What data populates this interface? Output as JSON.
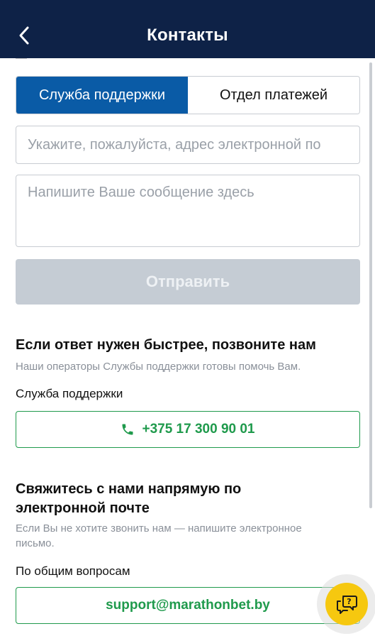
{
  "header": {
    "title": "Контакты"
  },
  "partial_text": "—",
  "tabs": [
    {
      "label": "Служба поддержки",
      "active": true
    },
    {
      "label": "Отдел платежей",
      "active": false
    }
  ],
  "form": {
    "email_placeholder": "Укажите, пожалуйста, адрес электронной по",
    "message_placeholder": "Напишите Ваше сообщение здесь",
    "send_label": "Отправить"
  },
  "call_section": {
    "title": "Если ответ нужен быстрее, позвоните нам",
    "subtitle": "Наши операторы Службы поддержки готовы помочь Вам.",
    "label": "Служба поддержки",
    "phone": "+375 17 300 90 01"
  },
  "email_section": {
    "title_line1": "Свяжитесь с нами напрямую по",
    "title_line2": "электронной почте",
    "subtitle_line1": "Если Вы не хотите звонить нам — напишите электронное",
    "subtitle_line2": "письмо.",
    "label": "По общим вопросам",
    "email": "support@marathonbet.by"
  },
  "colors": {
    "header_bg": "#0e2247",
    "tab_active": "#0a5ba6",
    "accent_green": "#1f9a4c",
    "send_disabled": "#c5ccd4",
    "fab": "#f6c80f"
  },
  "icons": {
    "back": "chevron-left-icon",
    "phone": "phone-icon",
    "chat": "chat-help-icon"
  }
}
